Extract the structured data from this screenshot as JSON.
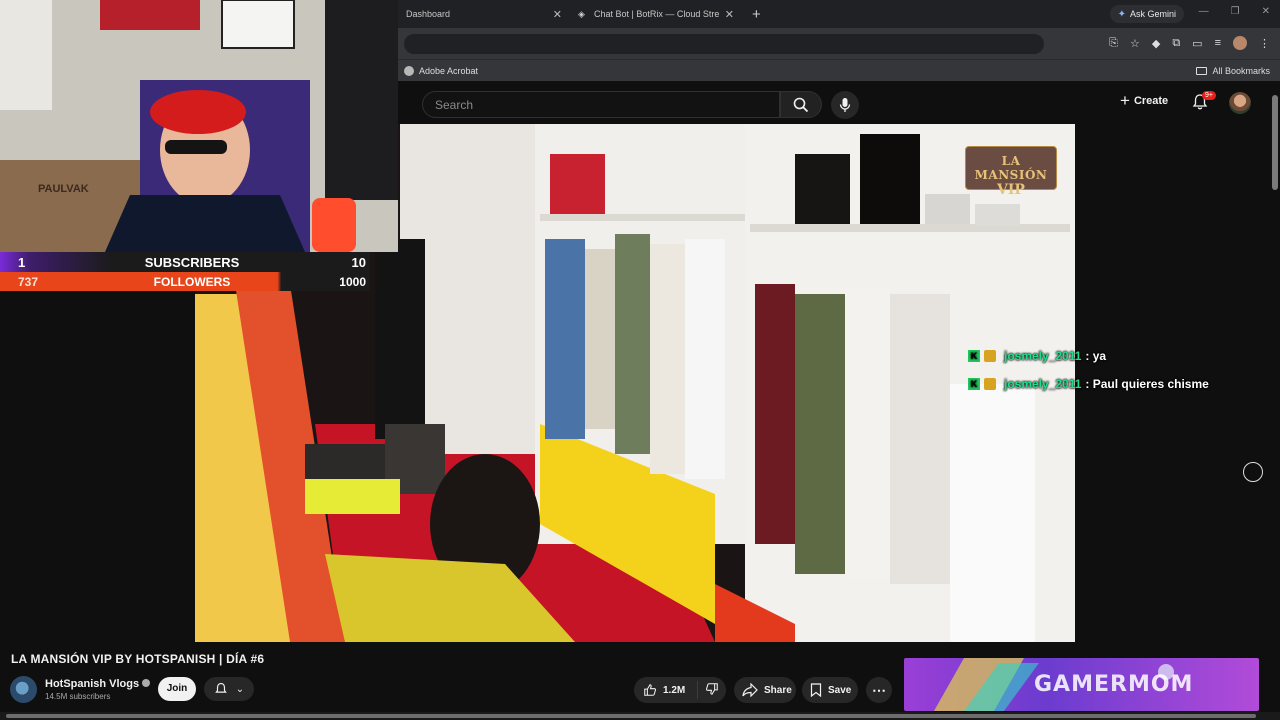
{
  "browser": {
    "tabs": [
      {
        "title": "Dashboard"
      },
      {
        "title": "Chat Bot | BotRix — Cloud Stre",
        "favicon": "botrix-icon"
      }
    ],
    "ask_gemini": "Ask Gemini",
    "bookmarks": {
      "item": "Adobe Acrobat",
      "all": "All Bookmarks"
    }
  },
  "youtube": {
    "search_placeholder": "Search",
    "create_label": "Create",
    "notifications_badge": "9+"
  },
  "overlay": {
    "subscribers": {
      "current": "1",
      "label": "SUBSCRIBERS",
      "goal": "10"
    },
    "followers": {
      "current": "737",
      "label": "FOLLOWERS",
      "goal": "1000"
    },
    "video_logo": {
      "line1": "LA MANSIÓN",
      "line2": "VIP"
    },
    "chat": [
      {
        "user": "josmely_2011",
        "message": "ya"
      },
      {
        "user": "josmely_2011",
        "message": "Paul quieres chisme"
      }
    ],
    "webcam_sign": "PAULVAK",
    "banner_text": "GAMERMOM"
  },
  "video": {
    "title": "LA MANSIÓN VIP BY HOTSPANISH | DÍA #6",
    "channel": "HotSpanish Vlogs",
    "subscribers": "14.5M subscribers",
    "join_label": "Join",
    "likes": "1.2M",
    "share_label": "Share",
    "save_label": "Save"
  },
  "colors": {
    "page_bg": "#0f0f0f",
    "followers_bar": "#e8451b",
    "subscribers_accent": "#7a2bd9",
    "chat_username": "#1fe08a"
  }
}
